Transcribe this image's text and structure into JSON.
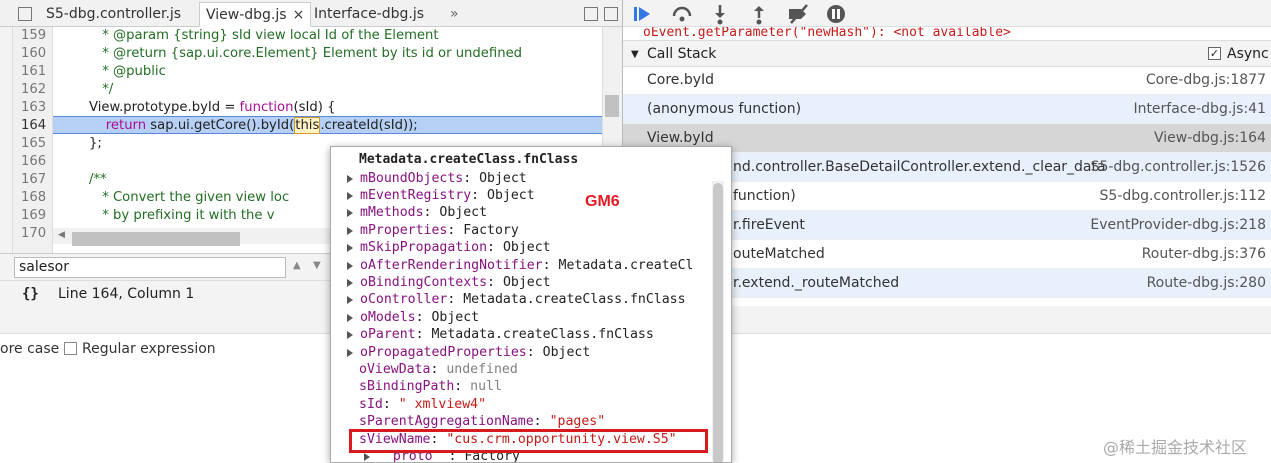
{
  "tabs": [
    {
      "label": "S5-dbg.controller.js"
    },
    {
      "label": "View-dbg.js"
    },
    {
      "label": "Interface-dbg.js"
    }
  ],
  "tab_overflow": "»",
  "code": {
    "lines": [
      {
        "no": "159",
        "text": " * @param {string} sId view local Id of the Element"
      },
      {
        "no": "160",
        "text": " * @return {sap.ui.core.Element} Element by its id or undefined"
      },
      {
        "no": "161",
        "text": " * @public"
      },
      {
        "no": "162",
        "text": " */"
      },
      {
        "no": "163",
        "pre": "View.prototype.byId = ",
        "kw": "function",
        "post": "(sId) {"
      },
      {
        "no": "164",
        "pre": "    ",
        "kw": "return",
        "mid": " sap.ui.getCore().byId(",
        "this": "this",
        "post": ".createId(sId));"
      },
      {
        "no": "165",
        "text": "};"
      },
      {
        "no": "166",
        "text": ""
      },
      {
        "no": "167",
        "text": "/**"
      },
      {
        "no": "168",
        "text": " * Convert the given view loc"
      },
      {
        "no": "169",
        "text": " * by prefixing it with the v"
      },
      {
        "no": "170",
        "text": ""
      }
    ]
  },
  "search": {
    "value": "salesor"
  },
  "status": {
    "icon": "{}",
    "position": "Line 164, Column 1"
  },
  "search_options": {
    "ignore_case": "ore case",
    "regex": "Regular expression"
  },
  "debugger": {
    "watch_text": "oEvent.getParameter(\"newHash\"): <not available>",
    "call_stack_title": "Call Stack",
    "async_label": "Async",
    "frames": [
      {
        "fn": "Core.byId",
        "loc": "Core-dbg.js:1877"
      },
      {
        "fn": "(anonymous function)",
        "loc": "Interface-dbg.js:41"
      },
      {
        "fn": "View.byId",
        "loc": "View-dbg.js:164"
      },
      {
        "fn": "nd.controller.BaseDetailController.extend._clear_data",
        "loc": "S5-dbg.controller.js:1526"
      },
      {
        "fn": "function)",
        "loc": "S5-dbg.controller.js:112"
      },
      {
        "fn": "r.fireEvent",
        "loc": "EventProvider-dbg.js:218"
      },
      {
        "fn": "outeMatched",
        "loc": "Router-dbg.js:376"
      },
      {
        "fn": "r.extend._routeMatched",
        "loc": "Route-dbg.js:280"
      }
    ]
  },
  "popover": {
    "title": "Metadata.createClass.fnClass",
    "annotation": "GM6",
    "props": [
      {
        "key": "mBoundObjects",
        "sep": ": ",
        "val": "Object",
        "exp": true
      },
      {
        "key": "mEventRegistry",
        "sep": ": ",
        "val": "Object",
        "exp": true
      },
      {
        "key": "mMethods",
        "sep": ": ",
        "val": "Object",
        "exp": true
      },
      {
        "key": "mProperties",
        "sep": ": ",
        "val": "Factory",
        "exp": true
      },
      {
        "key": "mSkipPropagation",
        "sep": ": ",
        "val": "Object",
        "exp": true
      },
      {
        "key": "oAfterRenderingNotifier",
        "sep": ": ",
        "val": "Metadata.createCl",
        "exp": true
      },
      {
        "key": "oBindingContexts",
        "sep": ": ",
        "val": "Object",
        "exp": true
      },
      {
        "key": "oController",
        "sep": ": ",
        "val": "Metadata.createClass.fnClass",
        "exp": true
      },
      {
        "key": "oModels",
        "sep": ": ",
        "val": "Object",
        "exp": true
      },
      {
        "key": "oParent",
        "sep": ": ",
        "val": "Metadata.createClass.fnClass",
        "exp": true
      },
      {
        "key": "oPropagatedProperties",
        "sep": ": ",
        "val": "Object",
        "exp": true
      },
      {
        "key": "oViewData",
        "sep": ": ",
        "val": "undefined",
        "exp": false,
        "kind": "undef"
      },
      {
        "key": "sBindingPath",
        "sep": ": ",
        "val": "null",
        "exp": false,
        "kind": "undef"
      },
      {
        "key": "sId",
        "sep": ": ",
        "val": "\"  xmlview4\"",
        "exp": false,
        "kind": "str"
      },
      {
        "key": "sParentAggregationName",
        "sep": ": ",
        "val": "\"pages\"",
        "exp": false,
        "kind": "str"
      },
      {
        "key": "sViewName",
        "sep": ": ",
        "val": "\"cus.crm.opportunity.view.S5\"",
        "exp": false,
        "kind": "str"
      },
      {
        "key": "__proto__",
        "sep": ": ",
        "val": "Factory",
        "exp": true
      }
    ]
  },
  "watermark": "@稀土掘金技术社区",
  "colors": {
    "highlight": "#b6d0f5",
    "annotation": "#e51b24",
    "selected_frame": "#d6d6d6"
  }
}
